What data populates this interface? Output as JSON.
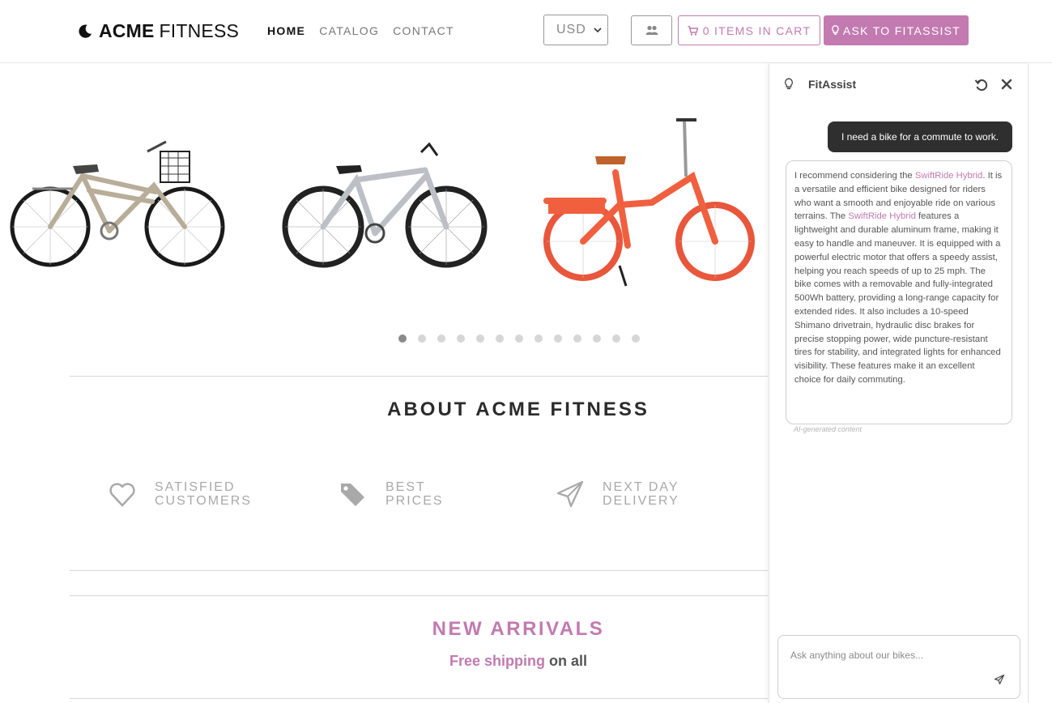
{
  "brand": {
    "name_bold": "ACME",
    "name_light": "FITNESS"
  },
  "nav": [
    {
      "label": "HOME",
      "active": true
    },
    {
      "label": "CATALOG",
      "active": false
    },
    {
      "label": "CONTACT",
      "active": false
    }
  ],
  "header": {
    "currency_value": "USD",
    "users_icon": "users-icon",
    "cart_label": "0 ITEMS IN CART",
    "cart_icon": "cart-icon",
    "ask_label": "ASK TO FITASSIST",
    "ask_icon": "lightbulb-icon",
    "accent_color": "#c27ab0"
  },
  "carousel": {
    "slides": [
      "beige-city-bike",
      "silver-mountain-bike",
      "red-folding-ebike"
    ],
    "dot_count": 13,
    "active_dot": 0
  },
  "about": {
    "title": "ABOUT ACME FITNESS",
    "features": [
      {
        "icon": "heart-icon",
        "line1": "SATISFIED",
        "line2": "CUSTOMERS"
      },
      {
        "icon": "tags-icon",
        "line1": "BEST",
        "line2": "PRICES"
      },
      {
        "icon": "paper-plane-icon",
        "line1": "NEXT DAY",
        "line2": "DELIVERY"
      }
    ]
  },
  "arrivals": {
    "title": "NEW ARRIVALS",
    "sub_highlight": "Free shipping",
    "sub_rest": " on all"
  },
  "chat": {
    "title": "FitAssist",
    "user_message": "I need a bike for a commute to work.",
    "bot_parts": [
      {
        "text": "I recommend considering the ",
        "link": false
      },
      {
        "text": "SwiftRide Hybrid",
        "link": true
      },
      {
        "text": ". It is a versatile and efficient bike designed for riders who want a smooth and enjoyable ride on various terrains. The ",
        "link": false
      },
      {
        "text": "SwiftRide Hybrid",
        "link": true
      },
      {
        "text": " features a lightweight and durable aluminum frame, making it easy to handle and maneuver. It is equipped with a powerful electric motor that offers a speedy assist, helping you reach speeds of up to 25 mph. The bike comes with a removable and fully-integrated 500Wh battery, providing a long-range capacity for extended rides. It also includes a 10-speed Shimano drivetrain, hydraulic disc brakes for precise stopping power, wide puncture-resistant tires for stability, and integrated lights for enhanced visibility. These features make it an excellent choice for daily commuting.",
        "link": false
      }
    ],
    "ai_note": "AI-generated content",
    "input_placeholder": "Ask anything about our bikes..."
  }
}
